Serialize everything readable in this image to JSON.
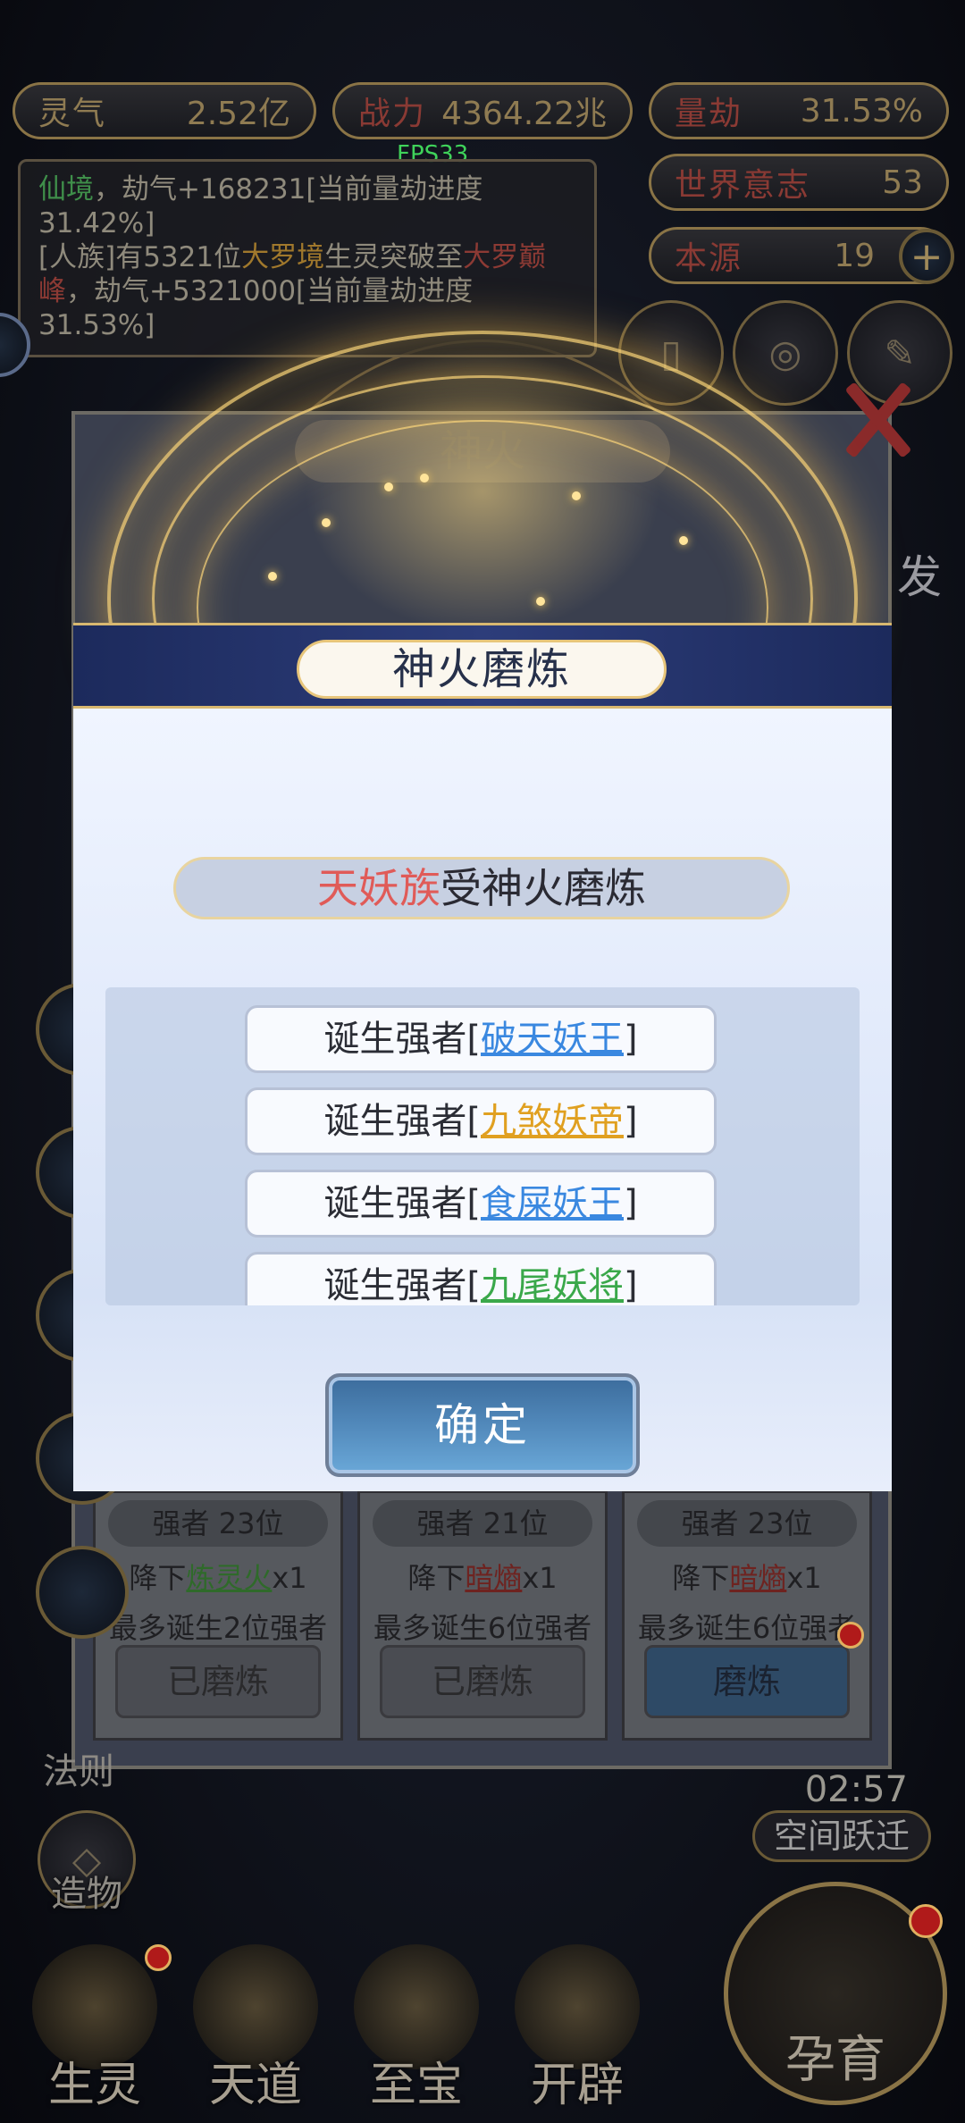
{
  "status": {
    "lingqi_label": "灵气",
    "lingqi_value": "2.52亿",
    "zhanli_label": "战力",
    "zhanli_value": "4364.22兆",
    "liangjie_label": "量劫",
    "liangjie_value": "31.53%",
    "world_will_label": "世界意志",
    "world_will_value": "53",
    "benyuan_label": "本源",
    "benyuan_value": "19",
    "fps": "FPS33"
  },
  "log": {
    "line1_a": "仙境",
    "line1_b": "，劫气+168231[当前量劫进度31.42%]",
    "line2_a": "[人族]有5321位",
    "line2_b": "大罗境",
    "line2_c": "生灵突破至",
    "line2_d": "大罗巅峰",
    "line2_e": "，劫气+5321000[当前量劫进度31.53%]"
  },
  "background_panel": {
    "title": "神火",
    "side_label": "发",
    "cards": [
      {
        "header": "强者 23位",
        "prefix": "降下",
        "item": "炼灵火",
        "suffix": "x1",
        "limit": "最多诞生2位强者",
        "button": "已磨炼"
      },
      {
        "header": "强者 21位",
        "prefix": "降下",
        "item": "暗熵",
        "suffix": "x1",
        "limit": "最多诞生6位强者",
        "button": "已磨炼"
      },
      {
        "header": "强者 23位",
        "prefix": "降下",
        "item": "暗熵",
        "suffix": "x1",
        "limit": "最多诞生6位强者",
        "button": "磨炼"
      }
    ]
  },
  "side_menu": {
    "fa_ze": "法则",
    "zao_wu": "造物",
    "timer": "02:57",
    "leap": "空间跃迁"
  },
  "bottom_nav": [
    {
      "label": "生灵"
    },
    {
      "label": "天道"
    },
    {
      "label": "至宝"
    },
    {
      "label": "开辟"
    },
    {
      "label": "孕育"
    }
  ],
  "modal": {
    "title": "神火磨炼",
    "race": "天妖族",
    "subtitle_rest": "受神火磨炼",
    "items": [
      {
        "prefix": "诞生强者[",
        "name": "破天妖王",
        "suffix": "]"
      },
      {
        "prefix": "诞生强者[",
        "name": "九煞妖帝",
        "suffix": "]"
      },
      {
        "prefix": "诞生强者[",
        "name": "食屎妖王",
        "suffix": "]"
      },
      {
        "prefix": "诞生强者[",
        "name": "九尾妖将",
        "suffix": "]"
      }
    ],
    "confirm": "确定"
  }
}
